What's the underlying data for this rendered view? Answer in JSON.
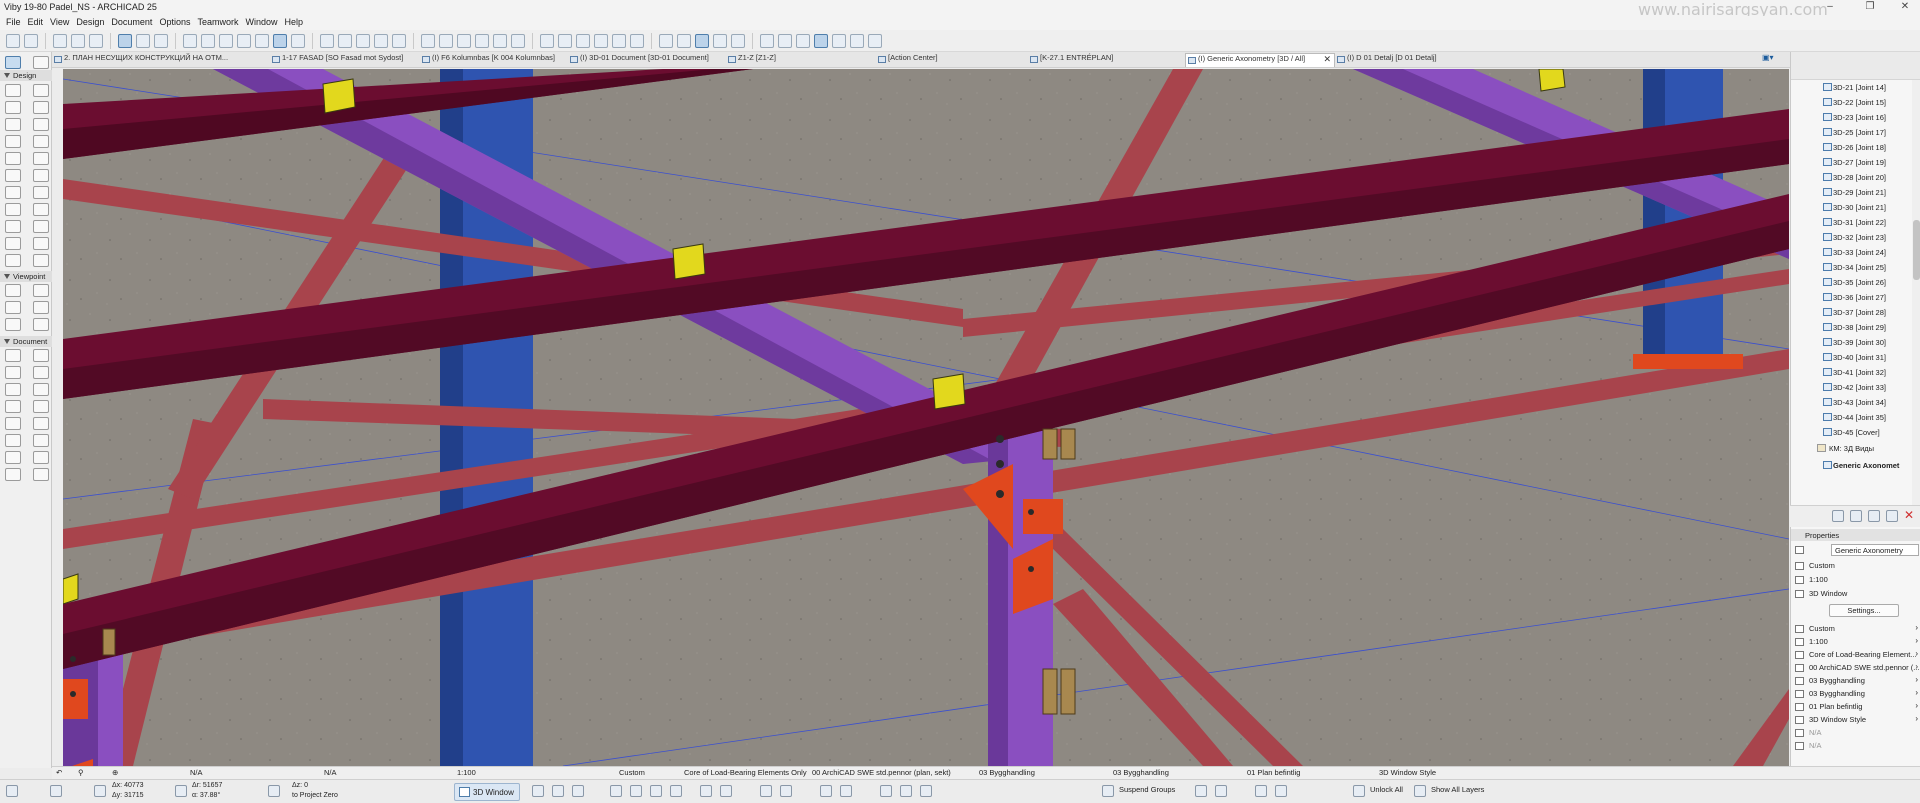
{
  "app": {
    "title": "Viby 19-80 Padel_NS - ARCHICAD 25",
    "watermark": "www.nairisargsyan.com",
    "window_controls": [
      "minimize-icon",
      "restore-icon",
      "close-icon"
    ]
  },
  "menu": [
    "File",
    "Edit",
    "View",
    "Design",
    "Document",
    "Options",
    "Teamwork",
    "Window",
    "Help"
  ],
  "tabs": [
    {
      "label": "2. ПЛАН НЕСУЩИХ КОНСТРУКЦИЙ НА ОТМ..."
    },
    {
      "label": "1-17 FASAD [SO Fasad mot Sydost]"
    },
    {
      "label": "(I) F6 Kolumnbas [K 004 Kolumnbas]"
    },
    {
      "label": "(I) 3D-01 Document [3D-01 Document]"
    },
    {
      "label": "Z1-Z [Z1-Z]"
    },
    {
      "label": "[Action Center]"
    },
    {
      "label": "[K-27.1 ENTRÉPLAN]"
    },
    {
      "label": "(I) Generic Axonometry [3D / All]",
      "active": true
    },
    {
      "label": "(I) D 01 Detalj [D 01 Detalj]"
    }
  ],
  "toolbox": {
    "sections": [
      "Design",
      "Viewpoint",
      "Document"
    ]
  },
  "navigator": {
    "items": [
      "3D-21 [Joint 14]",
      "3D-22 [Joint 15]",
      "3D-23 [Joint 16]",
      "3D-25 [Joint 17]",
      "3D-26 [Joint 18]",
      "3D-27 [Joint 19]",
      "3D-28 [Joint 20]",
      "3D-29 [Joint 21]",
      "3D-30 [Joint 21]",
      "3D-31 [Joint 22]",
      "3D-32 [Joint 23]",
      "3D-33 [Joint 24]",
      "3D-34 [Joint 25]",
      "3D-35 [Joint 26]",
      "3D-36 [Joint 27]",
      "3D-37 [Joint 28]",
      "3D-38 [Joint 29]",
      "3D-39 [Joint 30]",
      "3D-40 [Joint 31]",
      "3D-41 [Joint 32]",
      "3D-42 [Joint 33]",
      "3D-43 [Joint 34]",
      "3D-44 [Joint 35]",
      "3D-45 [Cover]"
    ],
    "folder": "КМ: 3Д Виды",
    "selected": "Generic Axonomet"
  },
  "properties": {
    "header": "Properties",
    "name": "Generic Axonometry",
    "rows_top": [
      "Custom",
      "1:100",
      "3D Window"
    ],
    "settings_label": "Settings...",
    "rows_bottom": [
      "Custom",
      "1:100",
      "Core of Load-Bearing Element...",
      "00 ArchiCAD SWE std.pennor (...",
      "03 Bygghandling",
      "03 Bygghandling",
      "01 Plan befintlig",
      "3D Window Style",
      "N/A",
      "N/A"
    ]
  },
  "status": {
    "row1": {
      "na_left": "N/A",
      "na_mid": "N/A",
      "scale": "1:100",
      "custom": "Custom",
      "structure": "Core of Load-Bearing Elements Only",
      "pen_set": "00 ArchiCAD SWE std.pennor (plan, sekt)",
      "layer_combo": "03 Bygghandling",
      "model_view": "03 Bygghandling",
      "renovation": "01 Plan befintlig",
      "style": "3D Window Style"
    },
    "row2": {
      "dx": "Δx: 40773",
      "dy": "Δy: 31715",
      "dr": "Δr: 51657",
      "da": "α: 37.88°",
      "dz": "Δz: 0",
      "ref": "to Project Zero",
      "window_label": "3D Window",
      "suspend": "Suspend Groups",
      "unlock": "Unlock All",
      "show_layers": "Show All Layers"
    }
  },
  "colors": {
    "beam_maroon": "#6b0d30",
    "beam_purple": "#8a4fc0",
    "column_blue": "#2f54b0",
    "brace_red": "#a8444c",
    "plate_orange": "#e0481e",
    "plate_yellow": "#e2d81d",
    "floor": "#8d8881"
  }
}
